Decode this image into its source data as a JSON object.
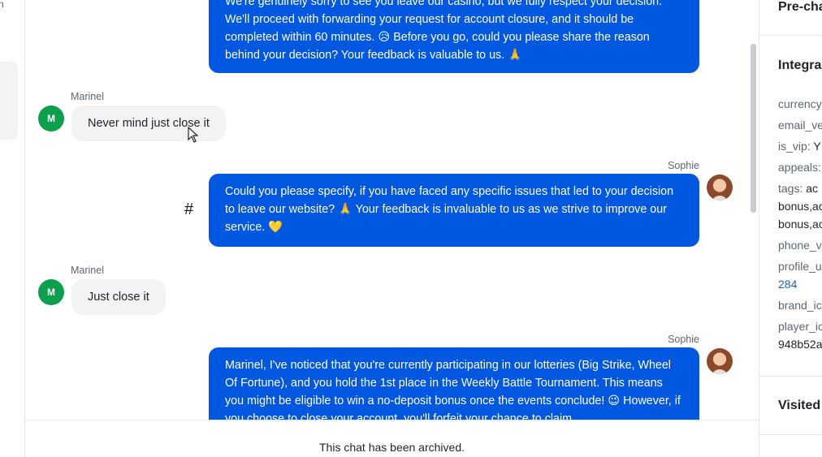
{
  "left_fragment": {
    "text": "n"
  },
  "messages": [
    {
      "role": "agent",
      "text": "We're genuinely sorry to see you leave our casino, but we fully respect your decision. We'll proceed with forwarding your request for account closure, and it should be completed within 60 minutes. 😥 Before you go, could you please share the reason behind your decision? Your feedback is valuable to us. 🙏"
    },
    {
      "role": "user",
      "sender": "Marinel",
      "avatar_initial": "M",
      "text": "Never mind just close it"
    },
    {
      "role": "agent",
      "sender": "Sophie",
      "text": "Could you please specify, if you have faced any specific issues that led to your decision to leave our website? 🙏 Your feedback is invaluable to us as we strive to improve our service. 💛"
    },
    {
      "role": "user",
      "sender": "Marinel",
      "avatar_initial": "M",
      "text": "Just close it"
    },
    {
      "role": "agent",
      "sender": "Sophie",
      "text": "Marinel, I've noticed that you're currently participating in our lotteries (Big Strike, Wheel Of Fortune), and you hold the 1st place in the Weekly Battle Tournament. This means you might be eligible to win a no-deposit bonus once the events conclude! 😉 However, if you choose to close your account, you'll forfeit your chance to claim"
    }
  ],
  "hash_symbol": "#",
  "archived_notice": "This chat has been archived.",
  "panel": {
    "prechat_title": "Pre-cha",
    "integrations_title": "Integra",
    "fields": [
      {
        "key": "currency",
        "value": ""
      },
      {
        "key": "email_ve",
        "value": ""
      },
      {
        "key": "is_vip: ",
        "value": "Y"
      },
      {
        "key": "appeals:",
        "value": ""
      },
      {
        "key": "tags: ",
        "value": "ac"
      },
      {
        "key": "",
        "value": "bonus,ac"
      },
      {
        "key": "",
        "value": "bonus,ac"
      },
      {
        "key": "phone_v",
        "value": ""
      },
      {
        "key": "profile_u",
        "value": ""
      },
      {
        "key": "",
        "value": "284"
      },
      {
        "key": "brand_ic",
        "value": ""
      },
      {
        "key": "player_ic",
        "value": ""
      },
      {
        "key": "",
        "value": "948b52a"
      }
    ],
    "visited_title": "Visited"
  },
  "colors": {
    "agent_bubble": "#0057e0",
    "user_bubble": "#f2f3f5",
    "user_avatar": "#0c9f4c",
    "link": "#1a5fd0"
  },
  "icons": {
    "cursor": "pointer-cursor-icon",
    "agent_avatar": "agent-photo-avatar"
  }
}
